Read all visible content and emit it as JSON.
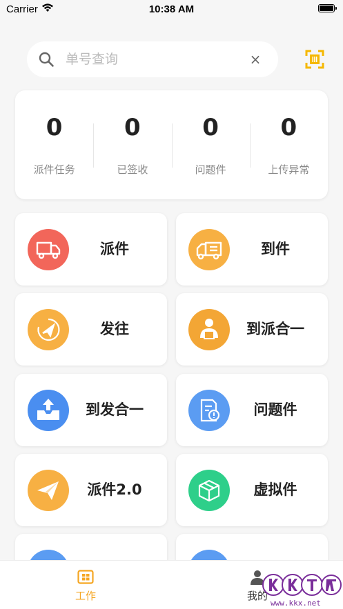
{
  "status_bar": {
    "carrier": "Carrier",
    "time": "10:38 AM"
  },
  "search": {
    "placeholder": "单号查询",
    "value": "",
    "clear_glyph": "×"
  },
  "stats": [
    {
      "value": "0",
      "label": "派件任务"
    },
    {
      "value": "0",
      "label": "已签收"
    },
    {
      "value": "0",
      "label": "问题件"
    },
    {
      "value": "0",
      "label": "上传异常"
    }
  ],
  "tiles": [
    {
      "label": "派件",
      "icon": "delivery-truck-icon",
      "color": "#f2665a"
    },
    {
      "label": "到件",
      "icon": "arrival-truck-icon",
      "color": "#f7b043"
    },
    {
      "label": "发往",
      "icon": "send-compass-icon",
      "color": "#f7b043"
    },
    {
      "label": "到派合一",
      "icon": "courier-package-icon",
      "color": "#f3a635"
    },
    {
      "label": "到发合一",
      "icon": "upload-tray-icon",
      "color": "#4a8ef0"
    },
    {
      "label": "问题件",
      "icon": "problem-document-icon",
      "color": "#5b9cf2"
    },
    {
      "label": "派件2.0",
      "icon": "paper-plane-icon",
      "color": "#f7b043"
    },
    {
      "label": "虚拟件",
      "icon": "virtual-box-icon",
      "color": "#2ecf8a"
    },
    {
      "label": "",
      "icon": "partial-icon",
      "color": "#5b9cf2"
    },
    {
      "label": "",
      "icon": "partial-icon",
      "color": "#5b9cf2"
    }
  ],
  "tab_bar": {
    "items": [
      {
        "label": "工作",
        "icon": "grid-icon",
        "active": true
      },
      {
        "label": "我的",
        "icon": "person-icon",
        "active": false
      }
    ],
    "accent": "#f5a623"
  },
  "watermark": {
    "site": "www.kkx.net"
  }
}
